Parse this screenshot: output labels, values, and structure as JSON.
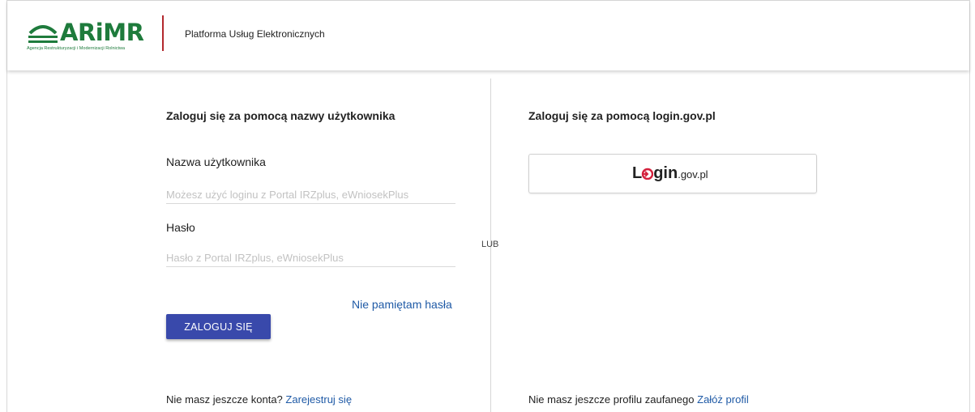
{
  "header": {
    "logo_text": "ARiMR",
    "logo_subtitle": "Agencja Restrukturyzacji i Modernizacji Rolnictwa",
    "title": "Platforma Usług Elektronicznych"
  },
  "left": {
    "title": "Zaloguj się za pomocą nazwy użytkownika",
    "username_label": "Nazwa użytkownika",
    "username_placeholder": "Możesz użyć loginu z Portal IRZplus, eWniosekPlus",
    "username_value": "",
    "password_label": "Hasło",
    "password_placeholder": "Hasło z Portal IRZplus, eWniosekPlus",
    "password_value": "",
    "forgot_link": "Nie pamiętam hasła",
    "login_button": "ZALOGUJ SIĘ",
    "register_prompt": "Nie masz jeszcze konta?",
    "register_link": "Zarejestruj się"
  },
  "divider_label": "LUB",
  "right": {
    "title": "Zaloguj się za pomocą login.gov.pl",
    "logingov_main": "Login",
    "logingov_domain": ".gov.pl",
    "profile_prompt": "Nie masz jeszcze profilu zaufanego",
    "profile_link": "Załóż profil"
  },
  "colors": {
    "brand_green": "#1e7b3c",
    "header_divider_red": "#b3282d",
    "button_blue": "#3949ab",
    "link_blue": "#1f5aa6",
    "logingov_red": "#d4213d"
  },
  "icons": {
    "logo_mark": "arimr-roof-icon",
    "logingov_mark": "login-arrow-icon"
  }
}
